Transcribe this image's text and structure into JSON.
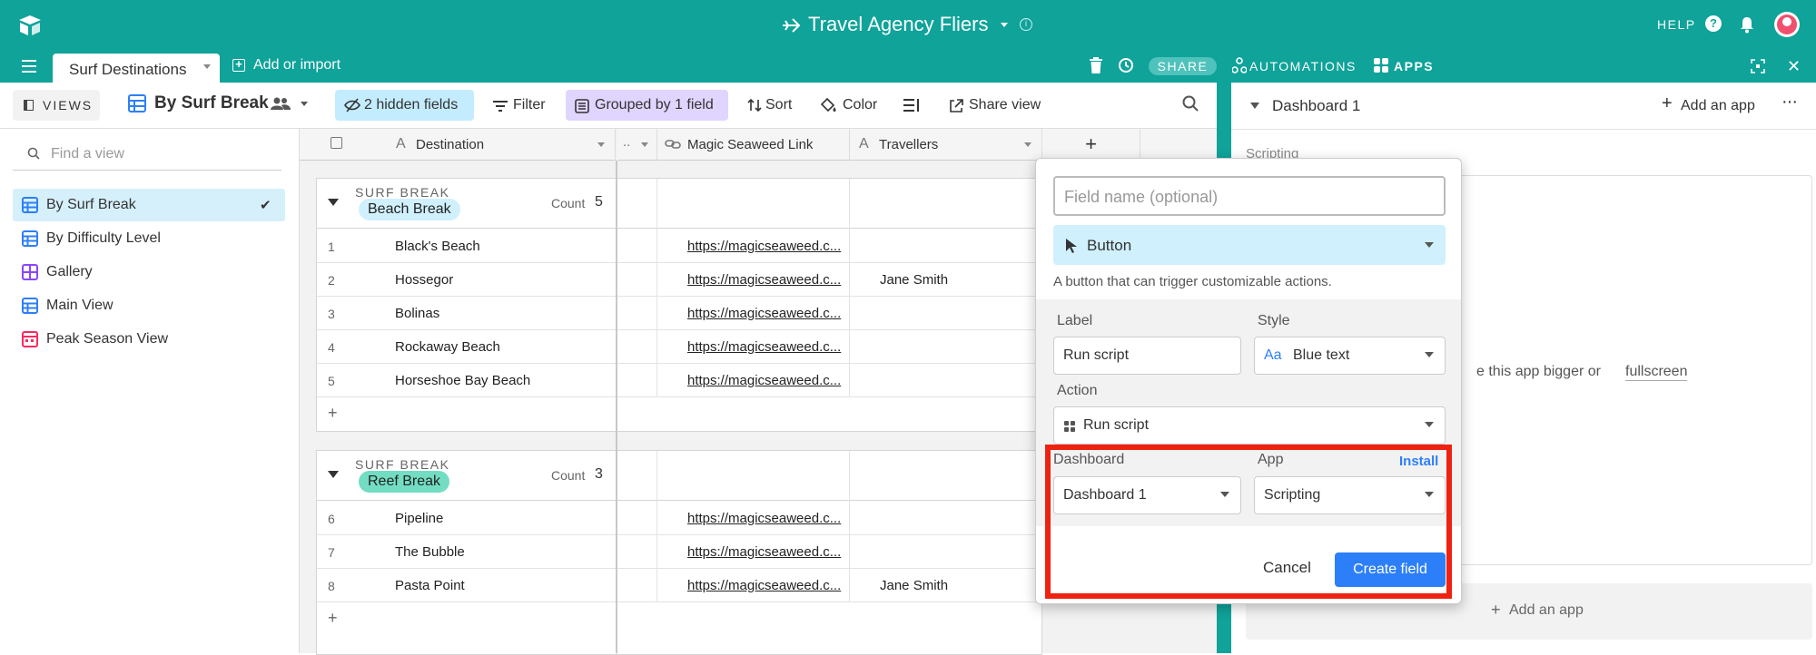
{
  "header": {
    "base_title": "Travel Agency Fliers",
    "help_label": "HELP"
  },
  "tabbar": {
    "table_tab": "Surf Destinations",
    "add_import": "Add or import",
    "share_label": "SHARE",
    "automations_label": "AUTOMATIONS",
    "apps_label": "APPS"
  },
  "viewbar": {
    "views_label": "VIEWS",
    "current_view": "By Surf Break",
    "hidden_fields": "2 hidden fields",
    "filter": "Filter",
    "grouped": "Grouped by 1 field",
    "sort": "Sort",
    "color": "Color",
    "share_view": "Share view"
  },
  "sidebar": {
    "find_placeholder": "Find a view",
    "items": [
      {
        "label": "By Surf Break",
        "icon": "grid-icon",
        "color": "#2d7ff9"
      },
      {
        "label": "By Difficulty Level",
        "icon": "grid-icon",
        "color": "#2d7ff9"
      },
      {
        "label": "Gallery",
        "icon": "gallery-icon",
        "color": "#8b46ff"
      },
      {
        "label": "Main View",
        "icon": "grid-icon",
        "color": "#2d7ff9"
      },
      {
        "label": "Peak Season View",
        "icon": "calendar-icon",
        "color": "#f82b60"
      }
    ]
  },
  "grid": {
    "columns": [
      "Destination",
      "Magic Seaweed Link",
      "Travellers"
    ],
    "add_column": "+",
    "groups": [
      {
        "field": "SURF BREAK",
        "value": "Beach Break",
        "pill_color": "#d0f0fd",
        "count_label": "Count",
        "count": "5",
        "rows": [
          {
            "n": "1",
            "destination": "Black's Beach",
            "link": "https://magicseaweed.c...",
            "travellers": ""
          },
          {
            "n": "2",
            "destination": "Hossegor",
            "link": "https://magicseaweed.c...",
            "travellers": "Jane Smith"
          },
          {
            "n": "3",
            "destination": "Bolinas",
            "link": "https://magicseaweed.c...",
            "travellers": ""
          },
          {
            "n": "4",
            "destination": "Rockaway Beach",
            "link": "https://magicseaweed.c...",
            "travellers": ""
          },
          {
            "n": "5",
            "destination": "Horseshoe Bay Beach",
            "link": "https://magicseaweed.c...",
            "travellers": ""
          }
        ]
      },
      {
        "field": "SURF BREAK",
        "value": "Reef Break",
        "pill_color": "#72ddc3",
        "count_label": "Count",
        "count": "3",
        "rows": [
          {
            "n": "6",
            "destination": "Pipeline",
            "link": "https://magicseaweed.c...",
            "travellers": ""
          },
          {
            "n": "7",
            "destination": "The Bubble",
            "link": "https://magicseaweed.c...",
            "travellers": ""
          },
          {
            "n": "8",
            "destination": "Pasta Point",
            "link": "https://magicseaweed.c...",
            "travellers": "Jane Smith"
          }
        ]
      }
    ],
    "add_row": "+"
  },
  "dashboard": {
    "title": "Dashboard 1",
    "add_app": "Add an app",
    "scripting_tab": "Scripting",
    "hint_text": "e this app bigger or",
    "hint_link": "fullscreen",
    "bottom_add_app": "Add an app"
  },
  "field_popup": {
    "name_placeholder": "Field name (optional)",
    "type": "Button",
    "type_description": "A button that can trigger customizable actions.",
    "label_label": "Label",
    "label_value": "Run script",
    "style_label": "Style",
    "style_prefix": "Aa",
    "style_value": "Blue text",
    "action_label": "Action",
    "action_value": "Run script",
    "dashboard_label": "Dashboard",
    "dashboard_value": "Dashboard 1",
    "app_label": "App",
    "install_label": "Install",
    "app_value": "Scripting",
    "cancel": "Cancel",
    "create": "Create field",
    "highlight_color": "#ee2211",
    "accent_color": "#2d7ff9"
  }
}
